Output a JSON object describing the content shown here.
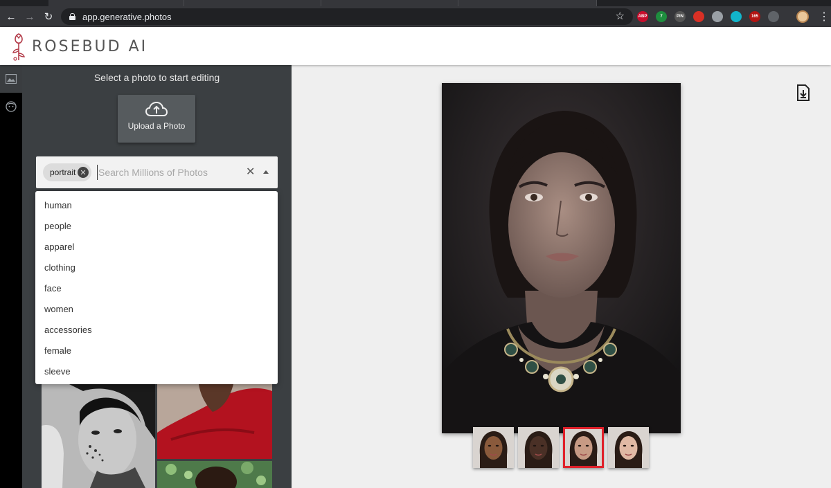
{
  "browser": {
    "url": "app.generative.photos",
    "extensions": [
      {
        "name": "adblock-plus-icon",
        "label": "ABP",
        "color": "#c70d2c"
      },
      {
        "name": "extension-green-icon",
        "label": "7",
        "color": "#1e8e3e"
      },
      {
        "name": "pin-ext-icon",
        "label": "PIN",
        "color": "#555555"
      },
      {
        "name": "red-hand-icon",
        "label": "",
        "color": "#d93025"
      },
      {
        "name": "grey-ext-icon",
        "label": "",
        "color": "#9aa0a6"
      },
      {
        "name": "teal-ext-icon",
        "label": "",
        "color": "#12b5cb"
      },
      {
        "name": "badge-ext-icon",
        "label": "165",
        "color": "#b31412"
      },
      {
        "name": "pocket-icon",
        "label": "",
        "color": "#5f6368"
      }
    ]
  },
  "header": {
    "brand": "ROSEBUD AI"
  },
  "sidebar": {
    "title": "Select a photo to start editing",
    "upload_label": "Upload a Photo",
    "search": {
      "chip": "portrait",
      "placeholder": "Search Millions of Photos",
      "suggestions": [
        "human",
        "people",
        "apparel",
        "clothing",
        "face",
        "women",
        "accessories",
        "female",
        "sleeve"
      ]
    }
  },
  "colors": {
    "panel": "#3b3f42",
    "selected_outline": "#e0202a",
    "brand": "#b23a48"
  },
  "faces": [
    {
      "name": "face-thumbnail-1",
      "skin": "#8a5a3c",
      "selected": false
    },
    {
      "name": "face-thumbnail-2",
      "skin": "#4a3026",
      "selected": false
    },
    {
      "name": "face-thumbnail-3",
      "skin": "#c79a84",
      "selected": true
    },
    {
      "name": "face-thumbnail-4",
      "skin": "#e0b9a4",
      "selected": false
    }
  ]
}
